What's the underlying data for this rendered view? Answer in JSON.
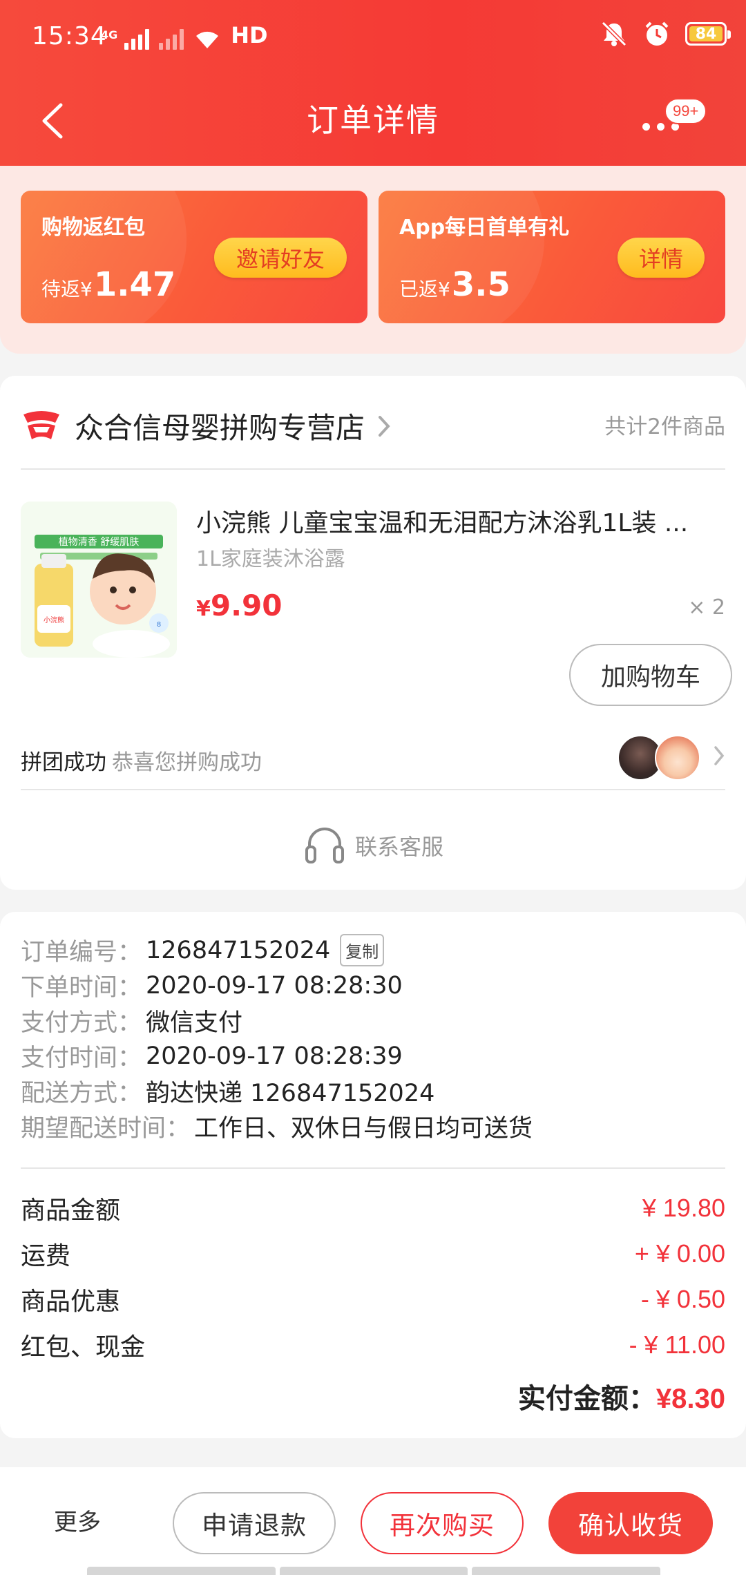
{
  "status_bar": {
    "time": "15:34",
    "network_tag": "4G",
    "hd_label": "HD",
    "battery_level": "84"
  },
  "nav": {
    "title": "订单详情",
    "badge": "99+"
  },
  "rebate": {
    "left": {
      "title": "购物返红包",
      "amount_prefix": "待返",
      "yen": "¥",
      "amount": "1.47",
      "button": "邀请好友"
    },
    "right": {
      "title": "App每日首单有礼",
      "amount_prefix": "已返",
      "yen": "¥",
      "amount": "3.5",
      "button": "详情"
    }
  },
  "shop": {
    "name": "众合信母婴拼购专营店",
    "item_count": "共计2件商品",
    "product": {
      "title": "小浣熊 儿童宝宝温和无泪配方沐浴乳1L装 ...",
      "subtitle": "1L家庭装沐浴露",
      "yen": "¥",
      "price": "9.90",
      "quantity": "× 2",
      "cart_button": "加购物车",
      "image_banner": "植物清香 舒缓肌肤",
      "image_brand": "小浣熊"
    },
    "group": {
      "status": "拼团成功",
      "message": "恭喜您拼购成功"
    },
    "service_label": "联系客服"
  },
  "order_info": {
    "rows": [
      {
        "key": "订单编号：",
        "value": "126847152024",
        "copy": "复制"
      },
      {
        "key": "下单时间：",
        "value": "2020-09-17 08:28:30"
      },
      {
        "key": "支付方式：",
        "value": "微信支付"
      },
      {
        "key": "支付时间：",
        "value": "2020-09-17 08:28:39"
      },
      {
        "key": "配送方式：",
        "value": "韵达快递 126847152024"
      },
      {
        "key": "期望配送时间：",
        "value": "工作日、双休日与假日均可送货"
      }
    ],
    "amounts": [
      {
        "key": "商品金额",
        "value": "¥ 19.80"
      },
      {
        "key": "运费",
        "value": "+ ¥ 0.00"
      },
      {
        "key": "商品优惠",
        "value": "- ¥ 0.50"
      },
      {
        "key": "红包、现金",
        "value": "- ¥ 11.00"
      }
    ],
    "total_label": "实付金额：",
    "total_value": "¥8.30"
  },
  "bottom_bar": {
    "more": "更多",
    "refund": "申请退款",
    "rebuy": "再次购买",
    "confirm": "确认收货"
  },
  "colors": {
    "brand_red": "#f2323a",
    "header_red": "#f53a35",
    "button_yellow": "#ffc928"
  }
}
